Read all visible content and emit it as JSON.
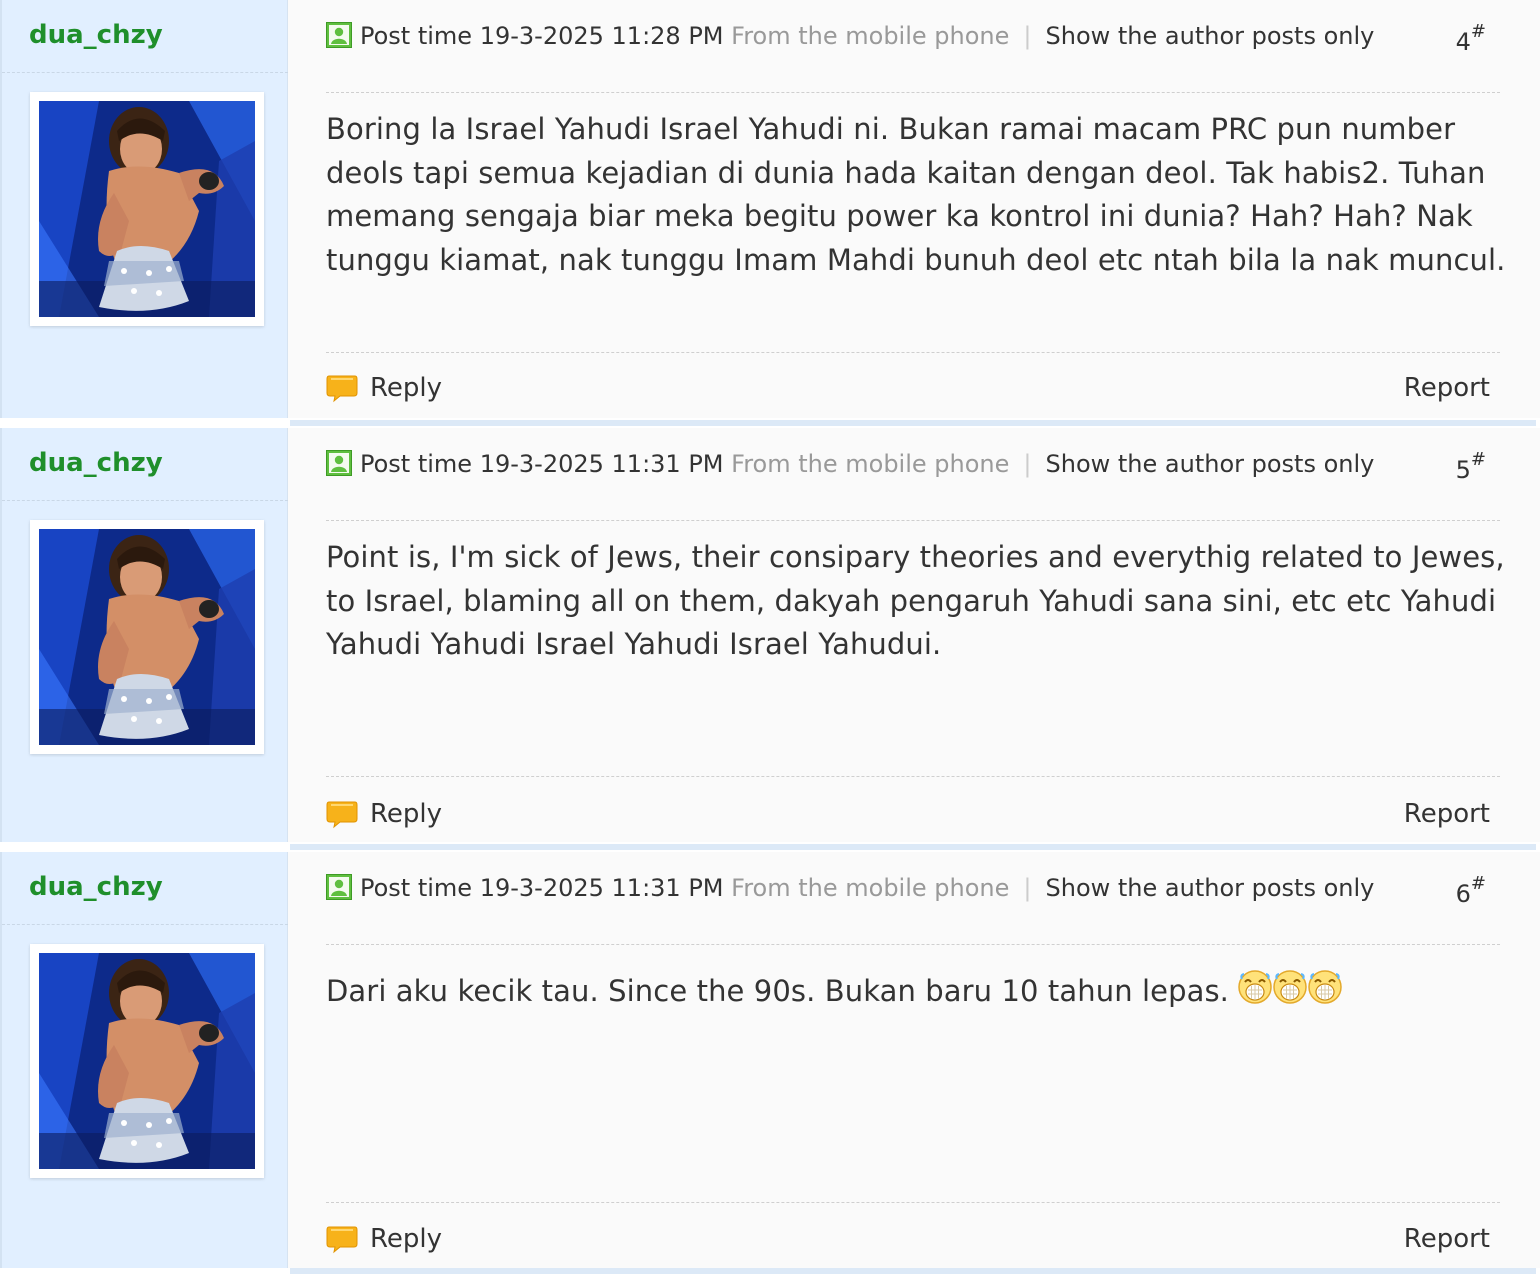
{
  "posts": [
    {
      "author": "dua_chzy",
      "post_time": "Post time 19-3-2025 11:28 PM",
      "source": "From the mobile phone",
      "only_author": "Show the author posts only",
      "floor": "4",
      "floor_mark": "#",
      "body": "Boring la Israel Yahudi Israel Yahudi ni. Bukan ramai macam PRC pun number deols tapi semua kejadian di dunia hada kaitan dengan deol. Tak habis2. Tuhan memang sengaja biar meka begitu power ka kontrol ini dunia? Hah? Hah? Nak tunggu kiamat, nak tunggu Imam Mahdi bunuh deol etc ntah bila la nak muncul.",
      "reply": "Reply",
      "report": "Report"
    },
    {
      "author": "dua_chzy",
      "post_time": "Post time 19-3-2025 11:31 PM",
      "source": "From the mobile phone",
      "only_author": "Show the author posts only",
      "floor": "5",
      "floor_mark": "#",
      "body": "Point is, I'm sick of Jews, their consipary theories and everythig related to Jewes, to Israel, blaming all on them, dakyah pengaruh Yahudi sana sini, etc etc Yahudi Yahudi Yahudi Israel Yahudi Israel Yahudui.",
      "reply": "Reply",
      "report": "Report"
    },
    {
      "author": "dua_chzy",
      "post_time": "Post time 19-3-2025 11:31 PM",
      "source": "From the mobile phone",
      "only_author": "Show the author posts only",
      "floor": "6",
      "floor_mark": "#",
      "body": "Dari aku kecik tau. Since the 90s. Bukan baru 10 tahun lepas.",
      "emoticons": [
        "laughing-emoticon",
        "laughing-emoticon",
        "laughing-emoticon"
      ],
      "reply": "Reply",
      "report": "Report"
    }
  ],
  "icons": {
    "online": "online-status-icon",
    "reply": "speech-bubble-icon"
  },
  "colors": {
    "author": "#1f8f2b",
    "sidebar": "#e1efff",
    "content": "#fafafa",
    "muted": "#999999"
  }
}
